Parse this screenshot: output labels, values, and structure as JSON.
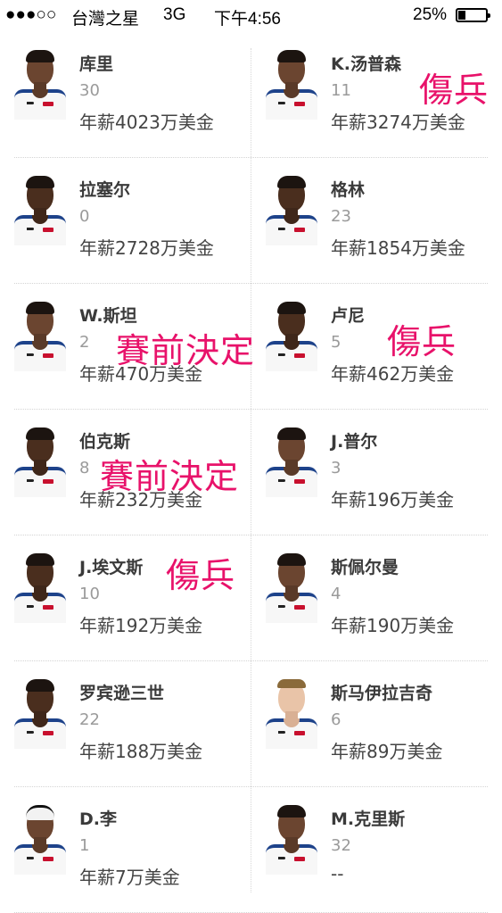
{
  "status_bar": {
    "signal": "●●●○○",
    "carrier": "台灣之星",
    "network": "3G",
    "time": "下午4:56",
    "battery": "25%"
  },
  "players": [
    {
      "name": "库里",
      "number": "30",
      "salary": "年薪4023万美金",
      "note": ""
    },
    {
      "name": "K.汤普森",
      "number": "11",
      "salary": "年薪3274万美金",
      "note": "傷兵"
    },
    {
      "name": "拉塞尔",
      "number": "0",
      "salary": "年薪2728万美金",
      "note": ""
    },
    {
      "name": "格林",
      "number": "23",
      "salary": "年薪1854万美金",
      "note": ""
    },
    {
      "name": "W.斯坦",
      "number": "2",
      "salary": "年薪470万美金",
      "note": "賽前決定"
    },
    {
      "name": "卢尼",
      "number": "5",
      "salary": "年薪462万美金",
      "note": "傷兵"
    },
    {
      "name": "伯克斯",
      "number": "8",
      "salary": "年薪232万美金",
      "note": "賽前決定"
    },
    {
      "name": "J.普尔",
      "number": "3",
      "salary": "年薪196万美金",
      "note": ""
    },
    {
      "name": "J.埃文斯",
      "number": "10",
      "salary": "年薪192万美金",
      "note": "傷兵"
    },
    {
      "name": "斯佩尔曼",
      "number": "4",
      "salary": "年薪190万美金",
      "note": ""
    },
    {
      "name": "罗宾逊三世",
      "number": "22",
      "salary": "年薪188万美金",
      "note": ""
    },
    {
      "name": "斯马伊拉吉奇",
      "number": "6",
      "salary": "年薪89万美金",
      "note": ""
    },
    {
      "name": "D.李",
      "number": "1",
      "salary": "年薪7万美金",
      "note": ""
    },
    {
      "name": "M.克里斯",
      "number": "32",
      "salary": "--",
      "note": ""
    }
  ]
}
